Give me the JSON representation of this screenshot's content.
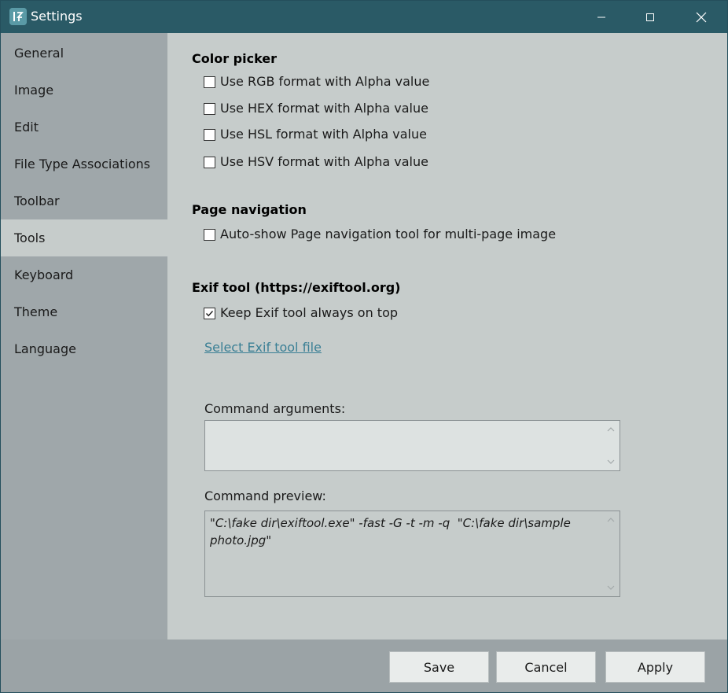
{
  "window": {
    "title": "Settings",
    "icons": {
      "app": "app-logo-icon",
      "minimize": "minimize-icon",
      "maximize": "maximize-icon",
      "close": "close-icon"
    },
    "colors": {
      "titlebar": "#2a5a66",
      "sidebar": "#9fa7aa",
      "content": "#c6cccb",
      "link": "#3a7f95"
    }
  },
  "sidebar": {
    "items": [
      {
        "label": "General",
        "selected": false
      },
      {
        "label": "Image",
        "selected": false
      },
      {
        "label": "Edit",
        "selected": false
      },
      {
        "label": "File Type Associations",
        "selected": false
      },
      {
        "label": "Toolbar",
        "selected": false
      },
      {
        "label": "Tools",
        "selected": true
      },
      {
        "label": "Keyboard",
        "selected": false
      },
      {
        "label": "Theme",
        "selected": false
      },
      {
        "label": "Language",
        "selected": false
      }
    ]
  },
  "color_picker": {
    "title": "Color picker",
    "options": [
      {
        "label": "Use RGB format with Alpha value",
        "checked": false
      },
      {
        "label": "Use HEX format with Alpha value",
        "checked": false
      },
      {
        "label": "Use HSL format with Alpha value",
        "checked": false
      },
      {
        "label": "Use HSV format with Alpha value",
        "checked": false
      }
    ]
  },
  "page_navigation": {
    "title": "Page navigation",
    "options": [
      {
        "label": "Auto-show Page navigation tool for multi-page image",
        "checked": false
      }
    ]
  },
  "exif_tool": {
    "title": "Exif tool (https://exiftool.org)",
    "options": [
      {
        "label": "Keep Exif tool always on top",
        "checked": true
      }
    ],
    "select_link": "Select Exif tool file",
    "arguments_label": "Command arguments:",
    "arguments_value": "",
    "preview_label": "Command preview:",
    "preview_value": "\"C:\\fake dir\\exiftool.exe\" -fast -G -t -m -q  \"C:\\fake dir\\sample photo.jpg\""
  },
  "footer": {
    "save": "Save",
    "cancel": "Cancel",
    "apply": "Apply"
  }
}
